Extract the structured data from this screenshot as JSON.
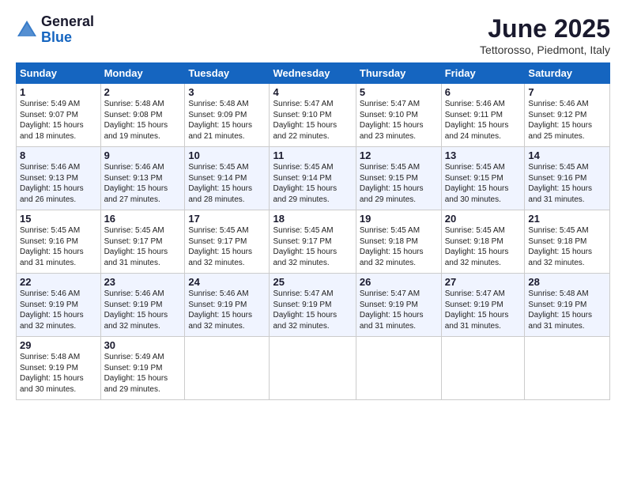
{
  "header": {
    "logo_general": "General",
    "logo_blue": "Blue",
    "month_title": "June 2025",
    "location": "Tettorosso, Piedmont, Italy"
  },
  "calendar": {
    "days_of_week": [
      "Sunday",
      "Monday",
      "Tuesday",
      "Wednesday",
      "Thursday",
      "Friday",
      "Saturday"
    ],
    "weeks": [
      [
        {
          "day": "1",
          "info": "Sunrise: 5:49 AM\nSunset: 9:07 PM\nDaylight: 15 hours\nand 18 minutes."
        },
        {
          "day": "2",
          "info": "Sunrise: 5:48 AM\nSunset: 9:08 PM\nDaylight: 15 hours\nand 19 minutes."
        },
        {
          "day": "3",
          "info": "Sunrise: 5:48 AM\nSunset: 9:09 PM\nDaylight: 15 hours\nand 21 minutes."
        },
        {
          "day": "4",
          "info": "Sunrise: 5:47 AM\nSunset: 9:10 PM\nDaylight: 15 hours\nand 22 minutes."
        },
        {
          "day": "5",
          "info": "Sunrise: 5:47 AM\nSunset: 9:10 PM\nDaylight: 15 hours\nand 23 minutes."
        },
        {
          "day": "6",
          "info": "Sunrise: 5:46 AM\nSunset: 9:11 PM\nDaylight: 15 hours\nand 24 minutes."
        },
        {
          "day": "7",
          "info": "Sunrise: 5:46 AM\nSunset: 9:12 PM\nDaylight: 15 hours\nand 25 minutes."
        }
      ],
      [
        {
          "day": "8",
          "info": "Sunrise: 5:46 AM\nSunset: 9:13 PM\nDaylight: 15 hours\nand 26 minutes."
        },
        {
          "day": "9",
          "info": "Sunrise: 5:46 AM\nSunset: 9:13 PM\nDaylight: 15 hours\nand 27 minutes."
        },
        {
          "day": "10",
          "info": "Sunrise: 5:45 AM\nSunset: 9:14 PM\nDaylight: 15 hours\nand 28 minutes."
        },
        {
          "day": "11",
          "info": "Sunrise: 5:45 AM\nSunset: 9:14 PM\nDaylight: 15 hours\nand 29 minutes."
        },
        {
          "day": "12",
          "info": "Sunrise: 5:45 AM\nSunset: 9:15 PM\nDaylight: 15 hours\nand 29 minutes."
        },
        {
          "day": "13",
          "info": "Sunrise: 5:45 AM\nSunset: 9:15 PM\nDaylight: 15 hours\nand 30 minutes."
        },
        {
          "day": "14",
          "info": "Sunrise: 5:45 AM\nSunset: 9:16 PM\nDaylight: 15 hours\nand 31 minutes."
        }
      ],
      [
        {
          "day": "15",
          "info": "Sunrise: 5:45 AM\nSunset: 9:16 PM\nDaylight: 15 hours\nand 31 minutes."
        },
        {
          "day": "16",
          "info": "Sunrise: 5:45 AM\nSunset: 9:17 PM\nDaylight: 15 hours\nand 31 minutes."
        },
        {
          "day": "17",
          "info": "Sunrise: 5:45 AM\nSunset: 9:17 PM\nDaylight: 15 hours\nand 32 minutes."
        },
        {
          "day": "18",
          "info": "Sunrise: 5:45 AM\nSunset: 9:17 PM\nDaylight: 15 hours\nand 32 minutes."
        },
        {
          "day": "19",
          "info": "Sunrise: 5:45 AM\nSunset: 9:18 PM\nDaylight: 15 hours\nand 32 minutes."
        },
        {
          "day": "20",
          "info": "Sunrise: 5:45 AM\nSunset: 9:18 PM\nDaylight: 15 hours\nand 32 minutes."
        },
        {
          "day": "21",
          "info": "Sunrise: 5:45 AM\nSunset: 9:18 PM\nDaylight: 15 hours\nand 32 minutes."
        }
      ],
      [
        {
          "day": "22",
          "info": "Sunrise: 5:46 AM\nSunset: 9:19 PM\nDaylight: 15 hours\nand 32 minutes."
        },
        {
          "day": "23",
          "info": "Sunrise: 5:46 AM\nSunset: 9:19 PM\nDaylight: 15 hours\nand 32 minutes."
        },
        {
          "day": "24",
          "info": "Sunrise: 5:46 AM\nSunset: 9:19 PM\nDaylight: 15 hours\nand 32 minutes."
        },
        {
          "day": "25",
          "info": "Sunrise: 5:47 AM\nSunset: 9:19 PM\nDaylight: 15 hours\nand 32 minutes."
        },
        {
          "day": "26",
          "info": "Sunrise: 5:47 AM\nSunset: 9:19 PM\nDaylight: 15 hours\nand 31 minutes."
        },
        {
          "day": "27",
          "info": "Sunrise: 5:47 AM\nSunset: 9:19 PM\nDaylight: 15 hours\nand 31 minutes."
        },
        {
          "day": "28",
          "info": "Sunrise: 5:48 AM\nSunset: 9:19 PM\nDaylight: 15 hours\nand 31 minutes."
        }
      ],
      [
        {
          "day": "29",
          "info": "Sunrise: 5:48 AM\nSunset: 9:19 PM\nDaylight: 15 hours\nand 30 minutes."
        },
        {
          "day": "30",
          "info": "Sunrise: 5:49 AM\nSunset: 9:19 PM\nDaylight: 15 hours\nand 29 minutes."
        },
        {
          "day": "",
          "info": ""
        },
        {
          "day": "",
          "info": ""
        },
        {
          "day": "",
          "info": ""
        },
        {
          "day": "",
          "info": ""
        },
        {
          "day": "",
          "info": ""
        }
      ]
    ]
  }
}
